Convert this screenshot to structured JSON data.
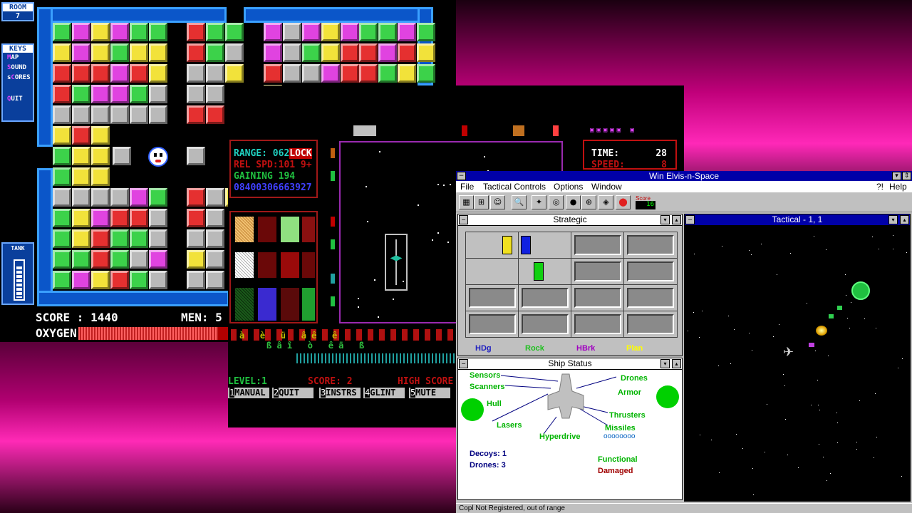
{
  "game1": {
    "room_label": "ROOM",
    "room_value": "7",
    "keys_title": "KEYS",
    "keys": [
      {
        "hot": "M",
        "rest": "AP"
      },
      {
        "hot": "S",
        "rest": "OUND"
      },
      {
        "hot": "S",
        "rest": "CORES",
        "prefix": "s"
      },
      {
        "hot": "Q",
        "rest": "UIT"
      }
    ],
    "tank_label": "TANK",
    "score_label": "SCORE : 1440",
    "men_label": "MEN: 5",
    "oxygen_label": "OXYGEN:",
    "oxygen_level": 0.37
  },
  "game2": {
    "range_label": "RANGE:",
    "range_value": "062",
    "lock_label": "LOCK",
    "rel_spd": "REL SPD:101 9+",
    "gaining": "GAINING 194",
    "digits": "08400306663927",
    "time_label": "TIME:",
    "time_value": "28",
    "speed_label": "SPEED:",
    "speed_value": "8",
    "level": "LEVEL:1",
    "score": "SCORE: 2",
    "high_score": "HIGH SCORE",
    "menu": [
      {
        "key": "1",
        "label": "MANUAL"
      },
      {
        "key": "2",
        "label": "QUIT"
      },
      {
        "key": "3",
        "label": "INSTRS"
      },
      {
        "key": "4",
        "label": "GLINT"
      },
      {
        "key": "5",
        "label": "MUTE"
      }
    ],
    "glyph_row": "à   è   ü   â ê   ê",
    "glyph_row2": "ß â î   ò   ê ä   ß"
  },
  "win": {
    "title": "Win Elvis-n-Space",
    "menu": [
      "File",
      "Tactical Controls",
      "Options",
      "Window"
    ],
    "help_q": "?!",
    "help": "Help",
    "score_label": "Score",
    "score_value": "16",
    "strategic_title": "Strategic",
    "tactical_title": "Tactical - 1, 1",
    "ship_status_title": "Ship Status",
    "legend": [
      {
        "label": "HDg",
        "color": "#2020c0"
      },
      {
        "label": "Rock",
        "color": "#20c020"
      },
      {
        "label": "HBrk",
        "color": "#a000c0"
      },
      {
        "label": "Plan",
        "color": "#ffff00"
      }
    ],
    "ship_labels": {
      "sensors": "Sensors",
      "scanners": "Scanners",
      "drones": "Drones",
      "armor": "Armor",
      "hull": "Hull",
      "lasers": "Lasers",
      "thrusters": "Thrusters",
      "missiles": "Missiles",
      "hyperdrive": "Hyperdrive",
      "missile_count": "oooooooo"
    },
    "decoys": "Decoys: 1",
    "drones_count": "Drones: 3",
    "functional": "Functional",
    "damaged": "Damaged",
    "status": "Copl Not Registered, out of range",
    "colors": {
      "title_active": "#0000a8",
      "green": "#00b400",
      "dark_red": "#a00000",
      "blue_text": "#000080"
    }
  }
}
